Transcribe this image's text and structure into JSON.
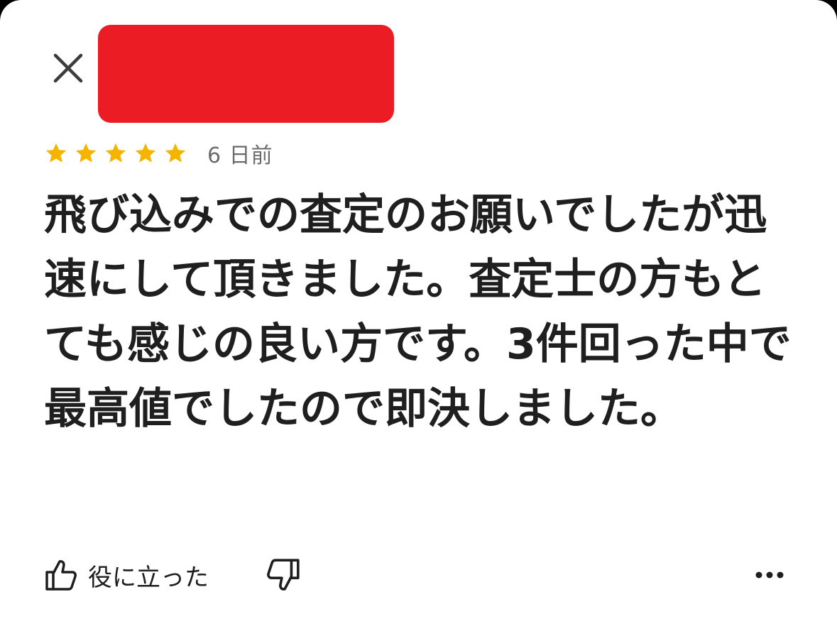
{
  "header": {
    "close_icon": "close-icon",
    "redaction_color": "#ec1c24"
  },
  "rating": {
    "stars": 5,
    "max_stars": 5,
    "star_color": "#f4b400",
    "date": "6 日前"
  },
  "review": {
    "text": "飛び込みでの査定のお願いでしたが迅速にして頂きました。査定士の方もとても感じの良い方です。3件回った中で最高値でしたので即決しました。"
  },
  "actions": {
    "helpful_label": "役に立った",
    "thumbs_up_icon": "thumbs-up-icon",
    "thumbs_down_icon": "thumbs-down-icon",
    "more_icon": "more-horizontal-icon"
  }
}
